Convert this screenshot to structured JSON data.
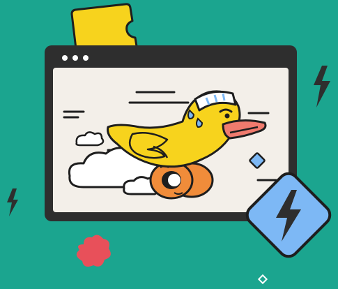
{
  "illustration": {
    "window": {
      "controls": [
        "dot",
        "dot",
        "dot"
      ]
    },
    "badge": {
      "icon": "lightning-bolt-icon"
    },
    "decor_icons": [
      "ticket-icon",
      "lightning-bolt-icon",
      "lightning-bolt-icon",
      "flower-blob-icon",
      "diamond-icon"
    ]
  },
  "colors": {
    "background": "#1BA58F",
    "window_frame": "#2E2E2E",
    "window_content": "#F3EFE9",
    "duck_body": "#F7D31D",
    "beak": "#F07B6E",
    "wheel": "#F08C3A",
    "headband": "#FFFFFF",
    "badge": "#7DB8F5",
    "ticket": "#F7D31D",
    "flower": "#E8505A"
  }
}
